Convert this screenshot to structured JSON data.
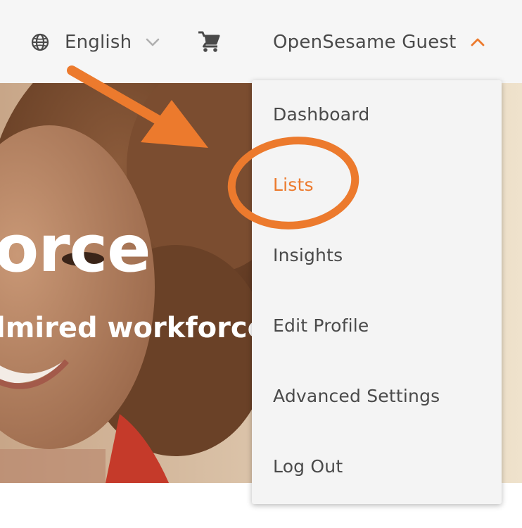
{
  "header": {
    "language_label": "English",
    "user_label": "OpenSesame Guest"
  },
  "hero": {
    "title": "orce",
    "subtitle": "lmired workforces."
  },
  "menu": {
    "items": [
      {
        "label": "Dashboard"
      },
      {
        "label": "Lists",
        "active": true
      },
      {
        "label": "Insights"
      },
      {
        "label": "Edit Profile"
      },
      {
        "label": "Advanced Settings"
      },
      {
        "label": "Log Out"
      }
    ]
  },
  "colors": {
    "accent": "#ec7a2d",
    "text": "#4a4a4a",
    "header_bg": "#f6f6f6",
    "menu_bg": "#f4f4f4"
  },
  "icons": {
    "language": "globe-icon",
    "language_toggle": "chevron-down-icon",
    "cart": "shopping-cart-icon",
    "user_toggle": "chevron-up-icon"
  }
}
